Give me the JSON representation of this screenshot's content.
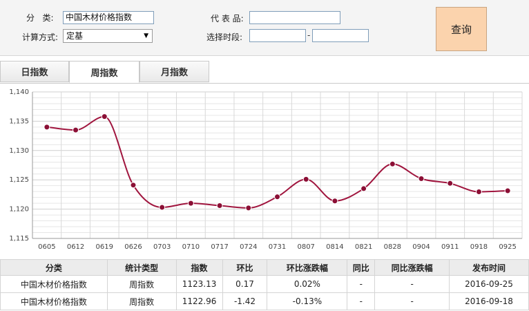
{
  "filter": {
    "category_label": "分   类:",
    "category_value": "中国木材价格指数",
    "method_label": "计算方式:",
    "method_value": "定基",
    "product_label": "代 表 品:",
    "product_value": "",
    "period_label": "选择时段:",
    "period_start": "",
    "period_end": "",
    "period_sep": "-",
    "query_button": "查询"
  },
  "tabs": [
    {
      "label": "日指数",
      "active": false
    },
    {
      "label": "周指数",
      "active": true
    },
    {
      "label": "月指数",
      "active": false
    }
  ],
  "chart_data": {
    "type": "line",
    "categories": [
      "0605",
      "0612",
      "0619",
      "0626",
      "0703",
      "0710",
      "0717",
      "0724",
      "0731",
      "0807",
      "0814",
      "0821",
      "0828",
      "0904",
      "0911",
      "0918",
      "0925"
    ],
    "values": [
      1134.0,
      1133.5,
      1135.8,
      1124.1,
      1120.3,
      1121.0,
      1120.6,
      1120.2,
      1122.1,
      1125.1,
      1121.4,
      1123.5,
      1127.7,
      1125.2,
      1124.4,
      1122.96,
      1123.13
    ],
    "ylim": [
      1115,
      1140
    ],
    "yticks": [
      1115,
      1120,
      1125,
      1130,
      1135,
      1140
    ],
    "ytick_labels": [
      "1,115",
      "1,120",
      "1,125",
      "1,130",
      "1,135",
      "1,140"
    ],
    "grid": true,
    "line_color": "#a0153e",
    "point_color": "#8b0f35"
  },
  "table": {
    "headers": [
      "分类",
      "统计类型",
      "指数",
      "环比",
      "环比涨跌幅",
      "同比",
      "同比涨跌幅",
      "发布时间"
    ],
    "rows": [
      {
        "category": "中国木材价格指数",
        "type": "周指数",
        "index": "1123.13",
        "mom": "0.17",
        "mom_pct": "0.02%",
        "yoy": "-",
        "yoy_pct": "-",
        "date": "2016-09-25",
        "trend": "up"
      },
      {
        "category": "中国木材价格指数",
        "type": "周指数",
        "index": "1122.96",
        "mom": "-1.42",
        "mom_pct": "-0.13%",
        "yoy": "-",
        "yoy_pct": "-",
        "date": "2016-09-18",
        "trend": "down"
      }
    ]
  }
}
